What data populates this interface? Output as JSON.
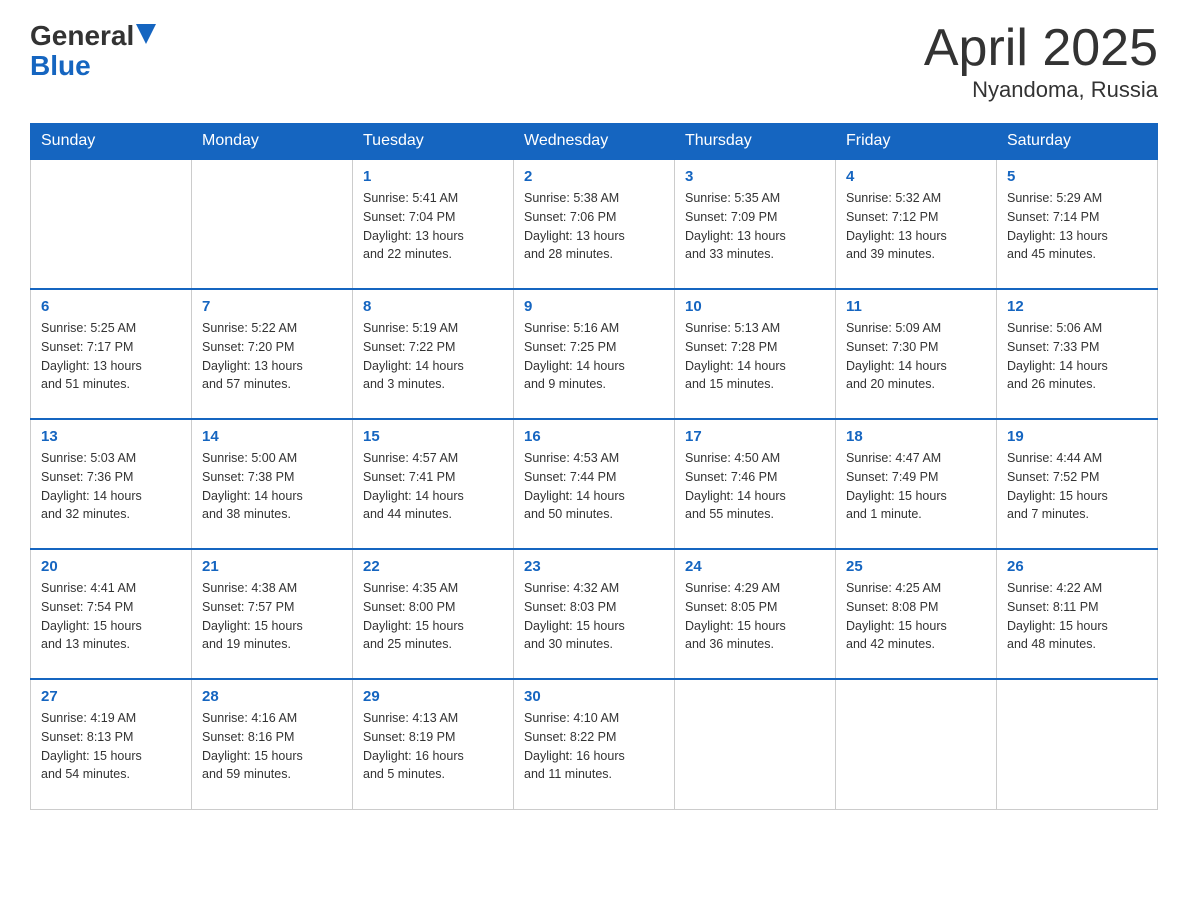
{
  "header": {
    "logo_general": "General",
    "logo_blue": "Blue",
    "title": "April 2025",
    "subtitle": "Nyandoma, Russia"
  },
  "weekdays": [
    "Sunday",
    "Monday",
    "Tuesday",
    "Wednesday",
    "Thursday",
    "Friday",
    "Saturday"
  ],
  "weeks": [
    [
      {
        "day": "",
        "info": ""
      },
      {
        "day": "",
        "info": ""
      },
      {
        "day": "1",
        "info": "Sunrise: 5:41 AM\nSunset: 7:04 PM\nDaylight: 13 hours\nand 22 minutes."
      },
      {
        "day": "2",
        "info": "Sunrise: 5:38 AM\nSunset: 7:06 PM\nDaylight: 13 hours\nand 28 minutes."
      },
      {
        "day": "3",
        "info": "Sunrise: 5:35 AM\nSunset: 7:09 PM\nDaylight: 13 hours\nand 33 minutes."
      },
      {
        "day": "4",
        "info": "Sunrise: 5:32 AM\nSunset: 7:12 PM\nDaylight: 13 hours\nand 39 minutes."
      },
      {
        "day": "5",
        "info": "Sunrise: 5:29 AM\nSunset: 7:14 PM\nDaylight: 13 hours\nand 45 minutes."
      }
    ],
    [
      {
        "day": "6",
        "info": "Sunrise: 5:25 AM\nSunset: 7:17 PM\nDaylight: 13 hours\nand 51 minutes."
      },
      {
        "day": "7",
        "info": "Sunrise: 5:22 AM\nSunset: 7:20 PM\nDaylight: 13 hours\nand 57 minutes."
      },
      {
        "day": "8",
        "info": "Sunrise: 5:19 AM\nSunset: 7:22 PM\nDaylight: 14 hours\nand 3 minutes."
      },
      {
        "day": "9",
        "info": "Sunrise: 5:16 AM\nSunset: 7:25 PM\nDaylight: 14 hours\nand 9 minutes."
      },
      {
        "day": "10",
        "info": "Sunrise: 5:13 AM\nSunset: 7:28 PM\nDaylight: 14 hours\nand 15 minutes."
      },
      {
        "day": "11",
        "info": "Sunrise: 5:09 AM\nSunset: 7:30 PM\nDaylight: 14 hours\nand 20 minutes."
      },
      {
        "day": "12",
        "info": "Sunrise: 5:06 AM\nSunset: 7:33 PM\nDaylight: 14 hours\nand 26 minutes."
      }
    ],
    [
      {
        "day": "13",
        "info": "Sunrise: 5:03 AM\nSunset: 7:36 PM\nDaylight: 14 hours\nand 32 minutes."
      },
      {
        "day": "14",
        "info": "Sunrise: 5:00 AM\nSunset: 7:38 PM\nDaylight: 14 hours\nand 38 minutes."
      },
      {
        "day": "15",
        "info": "Sunrise: 4:57 AM\nSunset: 7:41 PM\nDaylight: 14 hours\nand 44 minutes."
      },
      {
        "day": "16",
        "info": "Sunrise: 4:53 AM\nSunset: 7:44 PM\nDaylight: 14 hours\nand 50 minutes."
      },
      {
        "day": "17",
        "info": "Sunrise: 4:50 AM\nSunset: 7:46 PM\nDaylight: 14 hours\nand 55 minutes."
      },
      {
        "day": "18",
        "info": "Sunrise: 4:47 AM\nSunset: 7:49 PM\nDaylight: 15 hours\nand 1 minute."
      },
      {
        "day": "19",
        "info": "Sunrise: 4:44 AM\nSunset: 7:52 PM\nDaylight: 15 hours\nand 7 minutes."
      }
    ],
    [
      {
        "day": "20",
        "info": "Sunrise: 4:41 AM\nSunset: 7:54 PM\nDaylight: 15 hours\nand 13 minutes."
      },
      {
        "day": "21",
        "info": "Sunrise: 4:38 AM\nSunset: 7:57 PM\nDaylight: 15 hours\nand 19 minutes."
      },
      {
        "day": "22",
        "info": "Sunrise: 4:35 AM\nSunset: 8:00 PM\nDaylight: 15 hours\nand 25 minutes."
      },
      {
        "day": "23",
        "info": "Sunrise: 4:32 AM\nSunset: 8:03 PM\nDaylight: 15 hours\nand 30 minutes."
      },
      {
        "day": "24",
        "info": "Sunrise: 4:29 AM\nSunset: 8:05 PM\nDaylight: 15 hours\nand 36 minutes."
      },
      {
        "day": "25",
        "info": "Sunrise: 4:25 AM\nSunset: 8:08 PM\nDaylight: 15 hours\nand 42 minutes."
      },
      {
        "day": "26",
        "info": "Sunrise: 4:22 AM\nSunset: 8:11 PM\nDaylight: 15 hours\nand 48 minutes."
      }
    ],
    [
      {
        "day": "27",
        "info": "Sunrise: 4:19 AM\nSunset: 8:13 PM\nDaylight: 15 hours\nand 54 minutes."
      },
      {
        "day": "28",
        "info": "Sunrise: 4:16 AM\nSunset: 8:16 PM\nDaylight: 15 hours\nand 59 minutes."
      },
      {
        "day": "29",
        "info": "Sunrise: 4:13 AM\nSunset: 8:19 PM\nDaylight: 16 hours\nand 5 minutes."
      },
      {
        "day": "30",
        "info": "Sunrise: 4:10 AM\nSunset: 8:22 PM\nDaylight: 16 hours\nand 11 minutes."
      },
      {
        "day": "",
        "info": ""
      },
      {
        "day": "",
        "info": ""
      },
      {
        "day": "",
        "info": ""
      }
    ]
  ]
}
